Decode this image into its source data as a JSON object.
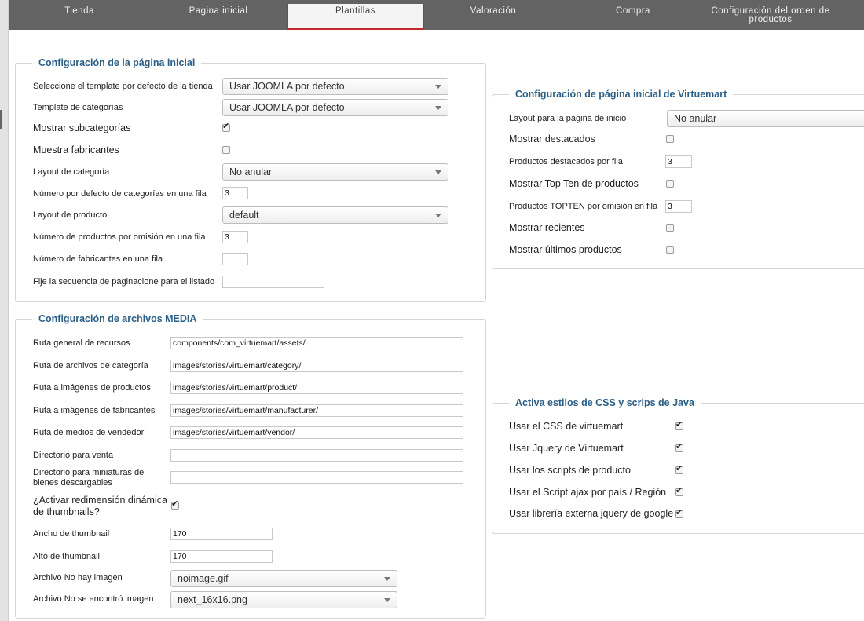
{
  "tabs": [
    "Tienda",
    "Pagina inicial",
    "Plantillas",
    "Valoración",
    "Compra",
    "Configuración del orden de productos"
  ],
  "frontpage": {
    "legend": "Configuración de la página inicial",
    "labels": [
      "Seleccione el template por defecto de la tienda",
      "Template de categorías",
      "Mostrar subcategorías",
      "Muestra fabricantes",
      "Layout de categoría",
      "Número por defecto de categorías en una fila",
      "Layout de producto",
      "Número de productos por omisión en una fila",
      "Número de fabricantes en una fila",
      "Fije la secuencia de paginacione para el listado"
    ],
    "template_default": "Usar JOOMLA por defecto",
    "category_template": "Usar JOOMLA por defecto",
    "show_subcategories": true,
    "show_manufacturers": false,
    "category_layout": "No anular",
    "categories_per_row": "3",
    "product_layout": "default",
    "products_per_row": "3",
    "manufacturers_per_row": "",
    "pagination_sequence": ""
  },
  "media": {
    "legend": "Configuración de archivos MEDIA",
    "labels": [
      "Ruta general de recursos",
      "Ruta de archivos de categoría",
      "Ruta a imágenes de productos",
      "Ruta a imágenes de fabricantes",
      "Ruta de medios de vendedor",
      "Directorio para venta",
      "Directorio para miniaturas de bienes descargables",
      "¿Activar redimensión dinámica de thumbnails?",
      "Ancho de thumbnail",
      "Alto de thumbnail",
      "Archivo No hay imagen",
      "Archivo No se encontró imagen"
    ],
    "assets_path": "components/com_virtuemart/assets/",
    "category_path": "images/stories/virtuemart/category/",
    "product_path": "images/stories/virtuemart/product/",
    "manufacturer_path": "images/stories/virtuemart/manufacturer/",
    "vendor_path": "images/stories/virtuemart/vendor/",
    "sale_dir": "",
    "download_thumb_dir": "",
    "dynamic_thumbnails": true,
    "thumb_width": "170",
    "thumb_height": "170",
    "no_image_file": "noimage.gif",
    "not_found_file": "next_16x16.png"
  },
  "vm_home": {
    "legend": "Configuración de página inicial de Virtuemart",
    "labels": [
      "Layout para la página de inicio",
      "Mostrar destacados",
      "Productos destacados por fila",
      "Mostrar Top Ten de productos",
      "Productos TOPTEN por omisión en fila",
      "Mostrar recientes",
      "Mostrar últimos productos"
    ],
    "home_layout": "No anular",
    "show_featured": false,
    "featured_per_row": "3",
    "show_topten": false,
    "topten_per_row": "3",
    "show_recent": false,
    "show_latest": false
  },
  "css_js": {
    "legend": "Activa estilos de CSS y scrips de Java",
    "labels": [
      "Usar el CSS de virtuemart",
      "Usar Jquery de Virtuemart",
      "Usar los scripts de producto",
      "Usar el Script ajax por país / Región",
      "Usar librería externa jquery de google"
    ],
    "values": [
      true,
      true,
      true,
      true,
      true
    ]
  }
}
